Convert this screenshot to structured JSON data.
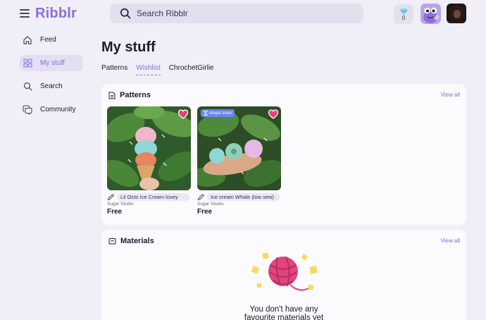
{
  "app": {
    "name": "Ribblr"
  },
  "header": {
    "search": {
      "placeholder": "Search Ribblr"
    },
    "gems": {
      "count": "0"
    }
  },
  "sidebar": {
    "items": [
      {
        "label": "Feed",
        "icon": "home-icon",
        "active": false
      },
      {
        "label": "My stuff",
        "icon": "grid-icon",
        "active": true
      },
      {
        "label": "Search",
        "icon": "search-icon",
        "active": false
      },
      {
        "label": "Community",
        "icon": "chat-bubbles-icon",
        "active": false
      }
    ]
  },
  "main": {
    "title": "My stuff",
    "tabs": [
      {
        "label": "Patterns",
        "active": false
      },
      {
        "label": "Wishlist",
        "active": true
      },
      {
        "label": "ChrochetGirlie",
        "active": false
      }
    ],
    "patterns_section": {
      "title": "Patterns",
      "view_all": "View all",
      "items": [
        {
          "name": "Lil Octo Ice Cream lovey",
          "studio": "Sugar Studio",
          "price": "Free",
          "badge": ""
        },
        {
          "name": "Ice cream Whale (low sew)",
          "studio": "Sugar Studio",
          "price": "Free",
          "badge": "drops soon"
        }
      ]
    },
    "materials_section": {
      "title": "Materials",
      "view_all": "View all",
      "empty_line1": "You don't have any",
      "empty_line2": "favourite materials yet"
    }
  },
  "colors": {
    "accent": "#8b6fd6",
    "heart": "#e0457b",
    "background": "#f0eef6",
    "badge": "#6a86f0"
  }
}
